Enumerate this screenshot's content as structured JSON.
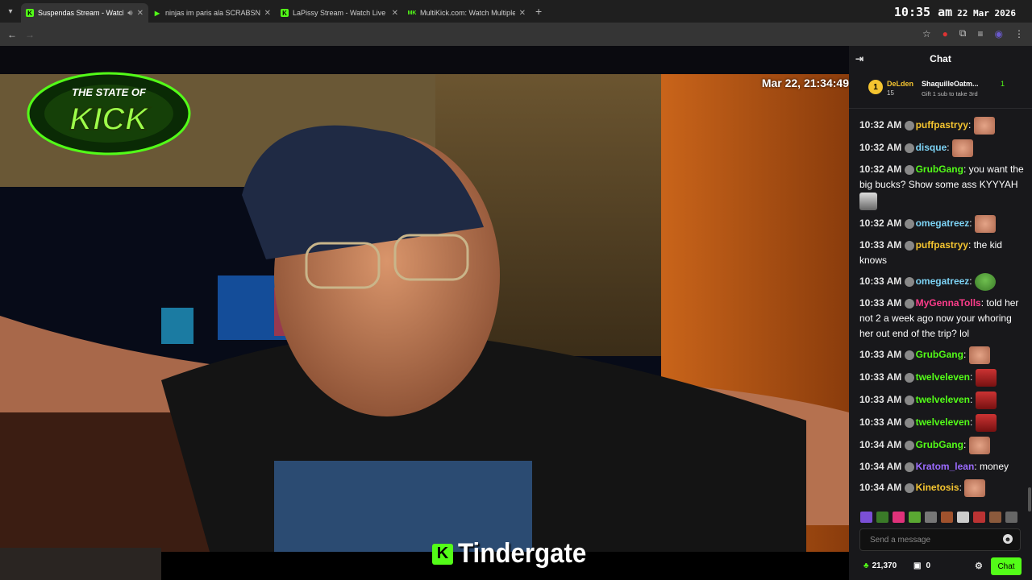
{
  "browser": {
    "tabs": [
      {
        "title": "Suspendas Stream - Watch",
        "active": true,
        "favicon": "K",
        "color": "#53fc18"
      },
      {
        "title": "ninjas im paris ala SCRABSNYC",
        "active": false,
        "favicon": "▶",
        "color": "#53fc18"
      },
      {
        "title": "LaPissy Stream - Watch Live on",
        "active": false,
        "favicon": "K",
        "color": "#53fc18"
      },
      {
        "title": "MultiKick.com: Watch Multiple",
        "active": false,
        "favicon": "MK",
        "color": "#53fc18"
      }
    ],
    "new_tab": "+",
    "close": "✕"
  },
  "clock": {
    "time": "10:35 am",
    "date": "22 Mar 2026"
  },
  "video": {
    "timestamp": "Mar 22, 21:34:49",
    "logo_top": "THE STATE OF",
    "logo_main": "KICK",
    "title_icon": "K",
    "title": "Tindergate"
  },
  "chat": {
    "header": "Chat",
    "pinned": {
      "rank": "1",
      "user1": "DeLden",
      "count1": "15",
      "user2": "ShaquilleOatm...",
      "count2": "1",
      "gift_text": "Gift 1 sub to take 3rd"
    },
    "messages": [
      {
        "time": "10:32 AM",
        "user": "puffpastryy",
        "color": "#f4c430",
        "text": "",
        "emote": "face"
      },
      {
        "time": "10:32 AM",
        "user": "disque",
        "color": "#7dd3f5",
        "text": "",
        "emote": "face"
      },
      {
        "time": "10:32 AM",
        "user": "GrubGang",
        "color": "#53fc18",
        "text": "you want the big bucks? Show some ass KYYYAH",
        "emote": "bw"
      },
      {
        "time": "10:32 AM",
        "user": "omegatreez",
        "color": "#7dd3f5",
        "text": "",
        "emote": "face"
      },
      {
        "time": "10:33 AM",
        "user": "puffpastryy",
        "color": "#f4c430",
        "text": "the kid knows",
        "emote": ""
      },
      {
        "time": "10:33 AM",
        "user": "omegatreez",
        "color": "#7dd3f5",
        "text": "",
        "emote": "green"
      },
      {
        "time": "10:33 AM",
        "user": "MyGennaTolls",
        "color": "#ff3d8b",
        "text": "told her not 2 a week ago now your whoring her out end of the trip? lol",
        "emote": ""
      },
      {
        "time": "10:33 AM",
        "user": "GrubGang",
        "color": "#53fc18",
        "text": "",
        "emote": "face"
      },
      {
        "time": "10:33 AM",
        "user": "twelveleven",
        "color": "#53fc18",
        "text": "",
        "emote": "red"
      },
      {
        "time": "10:33 AM",
        "user": "twelveleven",
        "color": "#53fc18",
        "text": "",
        "emote": "red"
      },
      {
        "time": "10:33 AM",
        "user": "twelveleven",
        "color": "#53fc18",
        "text": "",
        "emote": "red"
      },
      {
        "time": "10:34 AM",
        "user": "GrubGang",
        "color": "#53fc18",
        "text": "",
        "emote": "face"
      },
      {
        "time": "10:34 AM",
        "user": "Kratom_lean",
        "color": "#9b6bff",
        "text": "money",
        "emote": ""
      },
      {
        "time": "10:34 AM",
        "user": "Kinetosis",
        "color": "#f4c430",
        "text": "",
        "emote": "face"
      }
    ],
    "input_placeholder": "Send a message",
    "points": "21,370",
    "gifts": "0",
    "chat_button": "Chat"
  }
}
